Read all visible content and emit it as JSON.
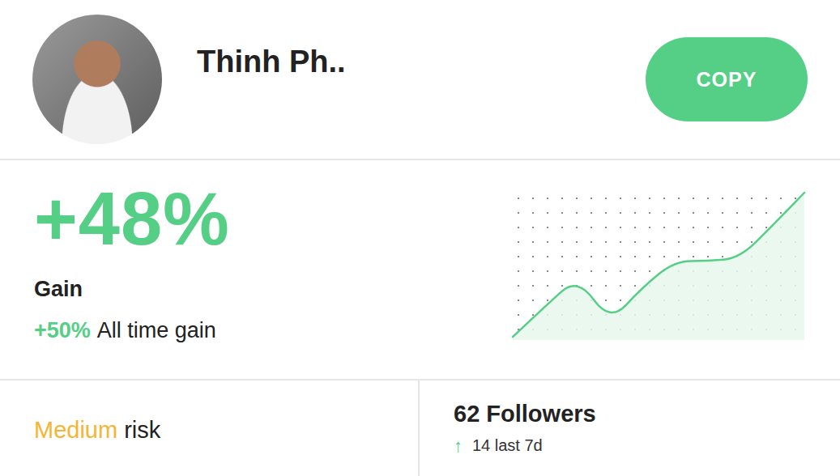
{
  "trader": {
    "name": "Thinh Ph..",
    "copy_button": "COPY"
  },
  "gain": {
    "value": "+48%",
    "label": "Gain",
    "all_time_value": "+50%",
    "all_time_label": "All time gain"
  },
  "chart": {
    "series": [
      {
        "name": "gain",
        "values": [
          1,
          22,
          42,
          11,
          35,
          53,
          53,
          55,
          77,
          100
        ]
      }
    ]
  },
  "risk": {
    "level": "Medium",
    "label": "risk"
  },
  "followers": {
    "count": "62 Followers",
    "delta_icon": "↑",
    "delta": "14 last 7d"
  }
}
